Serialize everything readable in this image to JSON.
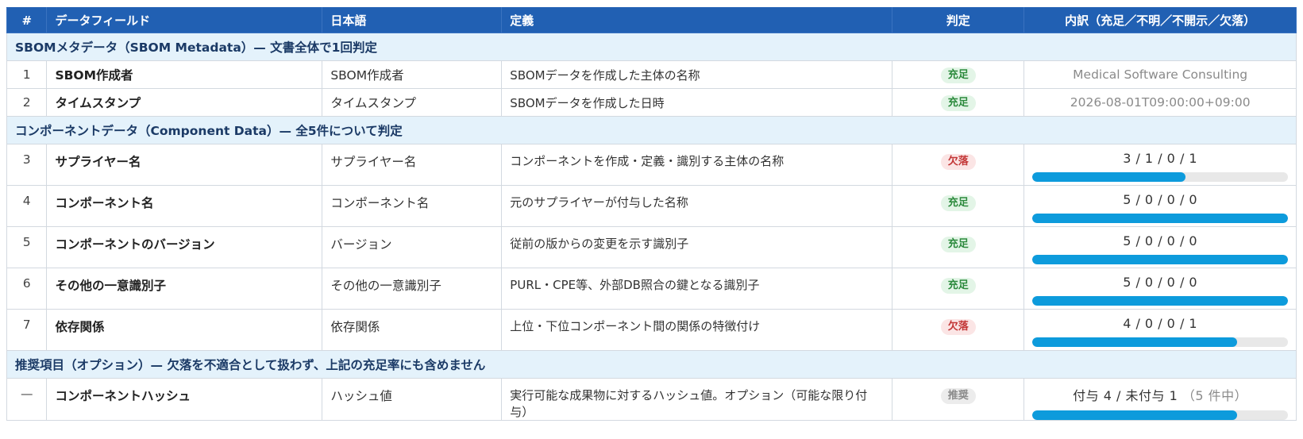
{
  "headers": {
    "num": "#",
    "field": "データフィールド",
    "japanese": "日本語",
    "definition": "定義",
    "judgement": "判定",
    "breakdown": "内訳（充足／不明／不開示／欠落）"
  },
  "sections": [
    {
      "title": "SBOMメタデータ（SBOM Metadata）— 文書全体で1回判定"
    },
    {
      "title": "コンポーネントデータ（Component Data）— 全5件について判定"
    },
    {
      "title": "推奨項目（オプション）— 欠落を不適合として扱わず、上記の充足率にも含めません"
    }
  ],
  "rows": [
    {
      "num": "1",
      "field": "SBOM作成者",
      "japanese": "SBOM作成者",
      "definition": "SBOMデータを作成した主体の名称",
      "judgement": "充足",
      "value": "Medical Software Consulting"
    },
    {
      "num": "2",
      "field": "タイムスタンプ",
      "japanese": "タイムスタンプ",
      "definition": "SBOMデータを作成した日時",
      "judgement": "充足",
      "value": "2026-08-01T09:00:00+09:00"
    },
    {
      "num": "3",
      "field": "サプライヤー名",
      "japanese": "サプライヤー名",
      "definition": "コンポーネントを作成・定義・識別する主体の名称",
      "judgement": "欠落",
      "breakdown": "3 / 1 / 0 / 1",
      "progress": 0.6
    },
    {
      "num": "4",
      "field": "コンポーネント名",
      "japanese": "コンポーネント名",
      "definition": "元のサプライヤーが付与した名称",
      "judgement": "充足",
      "breakdown": "5 / 0 / 0 / 0",
      "progress": 1.0
    },
    {
      "num": "5",
      "field": "コンポーネントのバージョン",
      "japanese": "バージョン",
      "definition": "従前の版からの変更を示す識別子",
      "judgement": "充足",
      "breakdown": "5 / 0 / 0 / 0",
      "progress": 1.0
    },
    {
      "num": "6",
      "field": "その他の一意識別子",
      "japanese": "その他の一意識別子",
      "definition": "PURL・CPE等、外部DB照合の鍵となる識別子",
      "judgement": "充足",
      "breakdown": "5 / 0 / 0 / 0",
      "progress": 1.0
    },
    {
      "num": "7",
      "field": "依存関係",
      "japanese": "依存関係",
      "definition": "上位・下位コンポーネント間の関係の特徴付け",
      "judgement": "欠落",
      "breakdown": "4 / 0 / 0 / 1",
      "progress": 0.8
    },
    {
      "num": "—",
      "field": "コンポーネントハッシュ",
      "japanese": "ハッシュ値",
      "definition": "実行可能な成果物に対するハッシュ値。オプション（可能な限り付与）",
      "judgement": "推奨",
      "breakdown": "付与 4 / 未付与 1",
      "note": "（5 件中）",
      "progress": 0.8
    }
  ],
  "colors": {
    "header_bg": "#2160b3",
    "section_bg": "#e4f2fb",
    "bar_fill": "#0d9bdc",
    "ok": "#2c8a3d",
    "ng": "#c33636",
    "rec": "#8a8a8a"
  }
}
